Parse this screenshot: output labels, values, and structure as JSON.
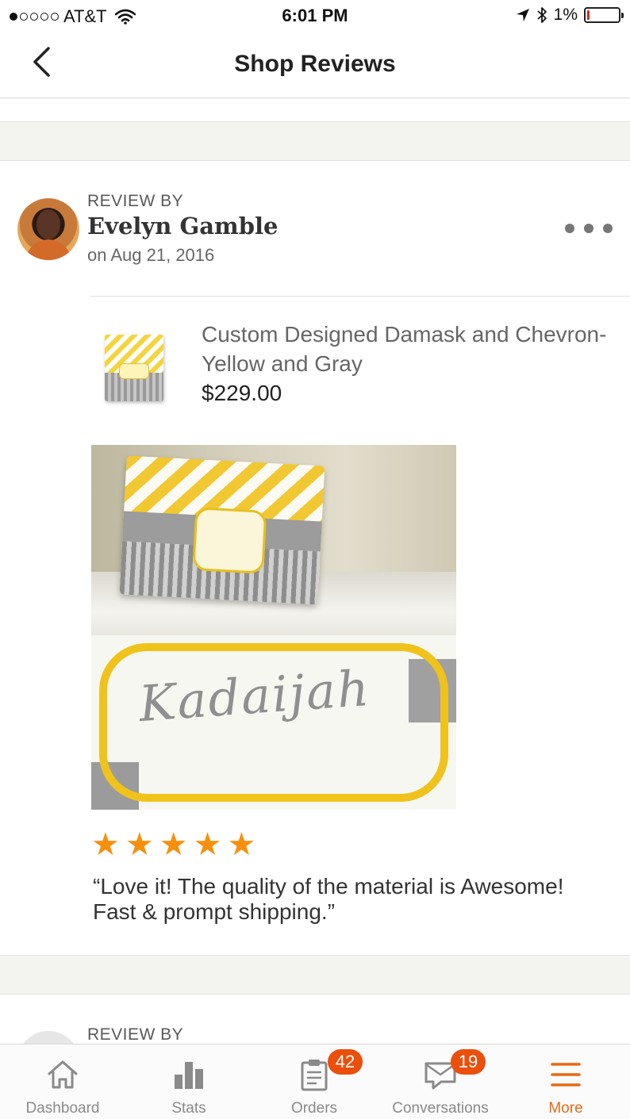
{
  "status_bar": {
    "carrier": "AT&T",
    "time": "6:01 PM",
    "battery": "1%",
    "battery_level": 0.01,
    "signal_bars_filled": 1,
    "signal_bars_total": 5
  },
  "nav": {
    "title": "Shop Reviews"
  },
  "review": {
    "review_by_label": "REVIEW BY",
    "reviewer_name": "Evelyn Gamble",
    "date": "on Aug 21, 2016",
    "listing": {
      "title": "Custom Designed Damask and Chevron-Yellow and Gray",
      "price": "$229.00"
    },
    "rating": 5,
    "rating_max": 5,
    "text": "“Love it! The quality of the material is Awesome! Fast & prompt shipping.”",
    "photo_text": "Kadaijah"
  },
  "next_review": {
    "review_by_label": "REVIEW BY"
  },
  "tab_bar": {
    "items": [
      {
        "label": "Dashboard",
        "icon": "home-icon"
      },
      {
        "label": "Stats",
        "icon": "bar-chart-icon"
      },
      {
        "label": "Orders",
        "icon": "clipboard-icon",
        "badge": "42"
      },
      {
        "label": "Conversations",
        "icon": "envelope-icon",
        "badge": "19"
      },
      {
        "label": "More",
        "icon": "menu-icon",
        "active": true
      }
    ]
  },
  "colors": {
    "accent": "#e86a14",
    "badge": "#ea4f0c",
    "star": "#f6900c",
    "band": "#f3f3ef"
  }
}
